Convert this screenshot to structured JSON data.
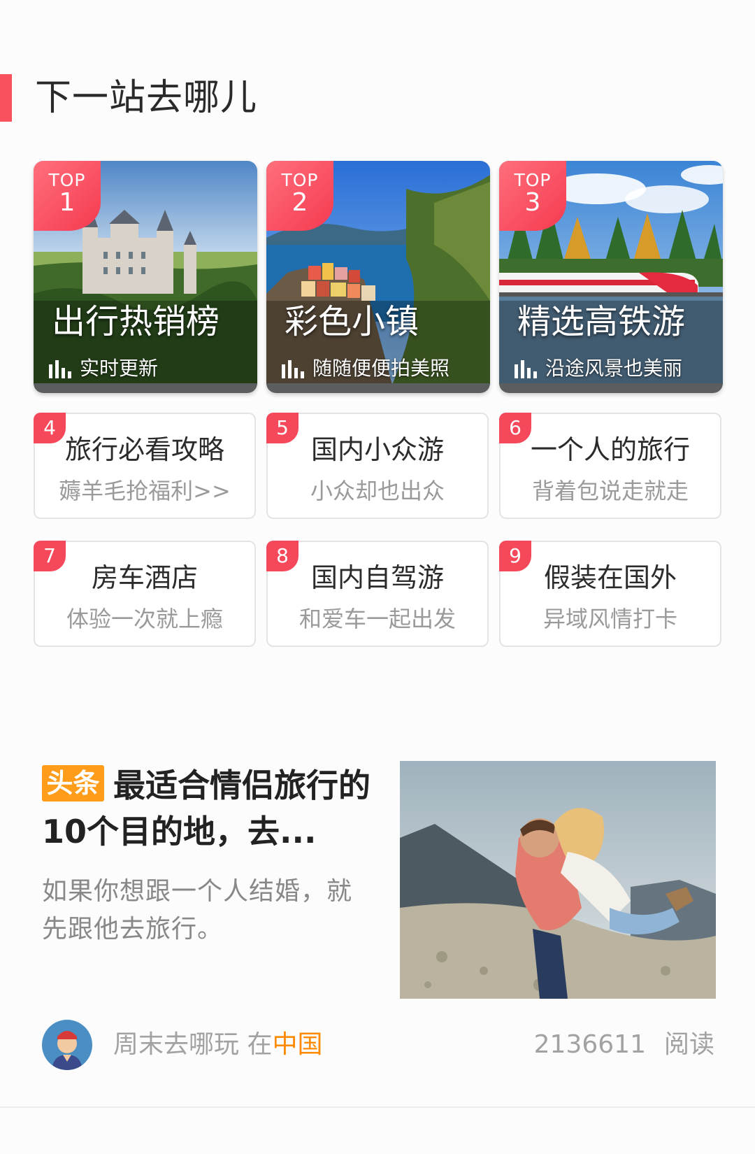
{
  "section": {
    "title": "下一站去哪儿"
  },
  "top_cards": [
    {
      "badge_label": "TOP",
      "rank": "1",
      "title": "出行热销榜",
      "subtitle": "实时更新"
    },
    {
      "badge_label": "TOP",
      "rank": "2",
      "title": "彩色小镇",
      "subtitle": "随随便便拍美照"
    },
    {
      "badge_label": "TOP",
      "rank": "3",
      "title": "精选高铁游",
      "subtitle": "沿途风景也美丽"
    }
  ],
  "rank_cards": [
    {
      "rank": "4",
      "title": "旅行必看攻略",
      "subtitle": "薅羊毛抢福利>>"
    },
    {
      "rank": "5",
      "title": "国内小众游",
      "subtitle": "小众却也出众"
    },
    {
      "rank": "6",
      "title": "一个人的旅行",
      "subtitle": "背着包说走就走"
    },
    {
      "rank": "7",
      "title": "房车酒店",
      "subtitle": "体验一次就上瘾"
    },
    {
      "rank": "8",
      "title": "国内自驾游",
      "subtitle": "和爱车一起出发"
    },
    {
      "rank": "9",
      "title": "假装在国外",
      "subtitle": "异域风情打卡"
    }
  ],
  "article": {
    "tag": "头条",
    "title": "最适合情侣旅行的10个目的地，去...",
    "description": "如果你想跟一个人结婚，就先跟他去旅行。",
    "author": "周末去哪玩",
    "location_prefix": "在",
    "location": "中国",
    "read_count": "2136611",
    "read_label": "阅读"
  },
  "colors": {
    "accent": "#f8525f",
    "tag": "#ff9c1a",
    "location": "#ff8a00"
  },
  "icons": {
    "stats": "bar-chart-icon",
    "avatar": "user-avatar"
  }
}
